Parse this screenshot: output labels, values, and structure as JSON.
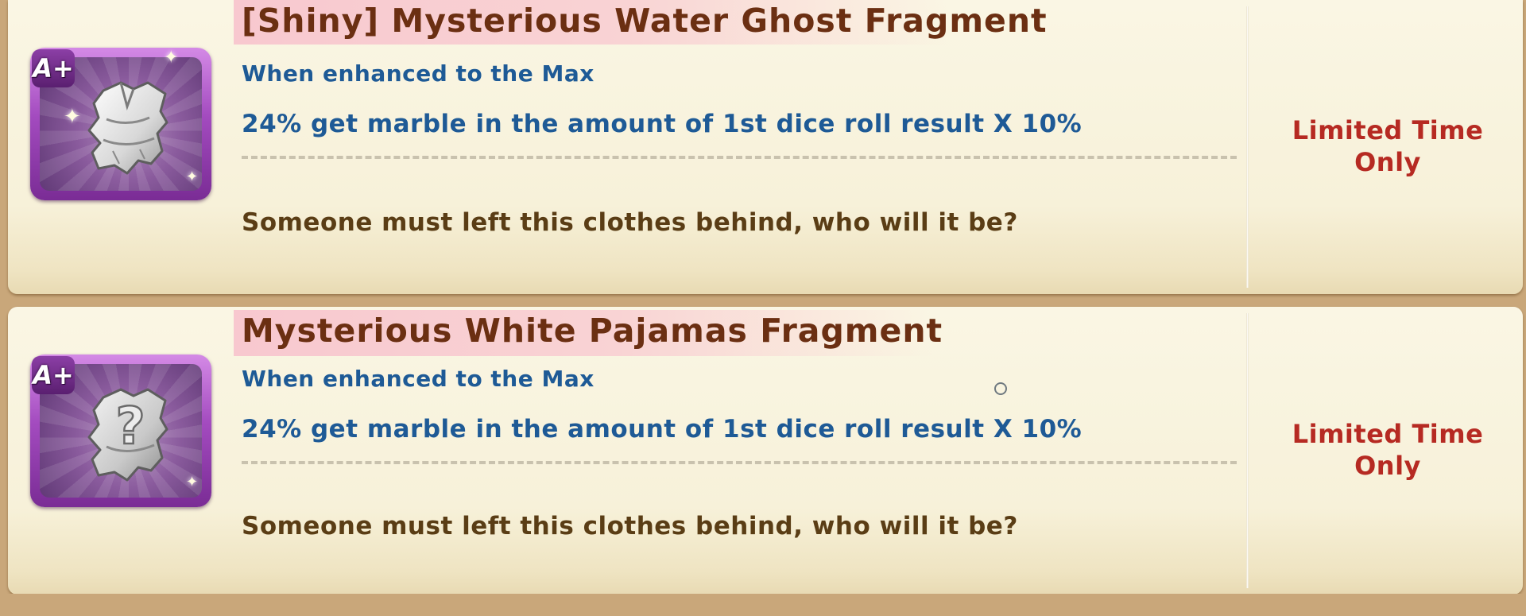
{
  "items": [
    {
      "grade": "A+",
      "title": "[Shiny] Mysterious Water Ghost Fragment",
      "enhance_label": "When enhanced to the Max",
      "effect": "24% get marble in the amount of 1st dice roll result X 10%",
      "description": "Someone must left this clothes behind, who will it be?",
      "availability": "Limited Time Only",
      "icon": "shiny-ghost-robe-icon"
    },
    {
      "grade": "A+",
      "title": "Mysterious White Pajamas Fragment",
      "enhance_label": "When enhanced to the Max",
      "effect": "24% get marble in the amount of 1st dice roll result X 10%",
      "description": "Someone must left this clothes behind, who will it be?",
      "availability": "Limited Time Only",
      "icon": "mystery-pajamas-icon"
    }
  ],
  "colors": {
    "title": "#6b2f12",
    "effect_text": "#1e5a96",
    "description_text": "#5a3d15",
    "limited_text": "#b62a22",
    "frame_purple": "#a34bbf",
    "card_background": "#f7f1d9",
    "page_background": "#c9a77a"
  }
}
